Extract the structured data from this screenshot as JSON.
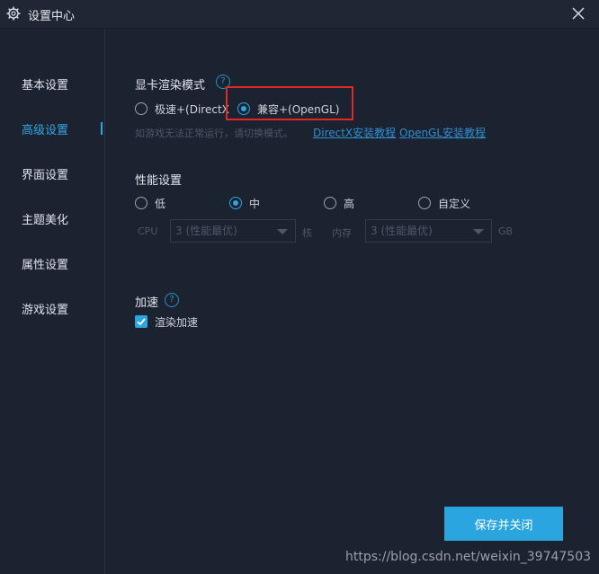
{
  "window": {
    "title": "设置中心"
  },
  "sidebar": {
    "items": [
      {
        "label": "基本设置"
      },
      {
        "label": "高级设置"
      },
      {
        "label": "界面设置"
      },
      {
        "label": "主题美化"
      },
      {
        "label": "属性设置"
      },
      {
        "label": "游戏设置"
      }
    ],
    "active_index": 1
  },
  "render_mode": {
    "title": "显卡渲染模式",
    "options": [
      {
        "label": "极速+(DirectX"
      },
      {
        "label": "兼容+(OpenGL)"
      }
    ],
    "selected": "兼容+(OpenGL)",
    "hint": "如游戏无法正常运行，请切换模式。",
    "links": [
      {
        "label": "DirectX安装教程"
      },
      {
        "label": "OpenGL安装教程"
      }
    ]
  },
  "performance": {
    "title": "性能设置",
    "options": [
      {
        "label": "低"
      },
      {
        "label": "中"
      },
      {
        "label": "高"
      },
      {
        "label": "自定义"
      }
    ],
    "selected": "中",
    "cpu": {
      "label": "CPU",
      "value": "3 (性能最优)",
      "unit": "核"
    },
    "memory": {
      "label": "内存",
      "value": "3 (性能最优)",
      "unit": "GB"
    }
  },
  "acceleration": {
    "title": "加速",
    "checkbox_label": "渲染加速",
    "checked": true
  },
  "footer": {
    "save_label": "保存并关闭",
    "watermark": "https://blog.csdn.net/weixin_39747503"
  },
  "colors": {
    "accent": "#2ba5e0",
    "highlight": "#e02a2a",
    "background": "#1b2230"
  }
}
